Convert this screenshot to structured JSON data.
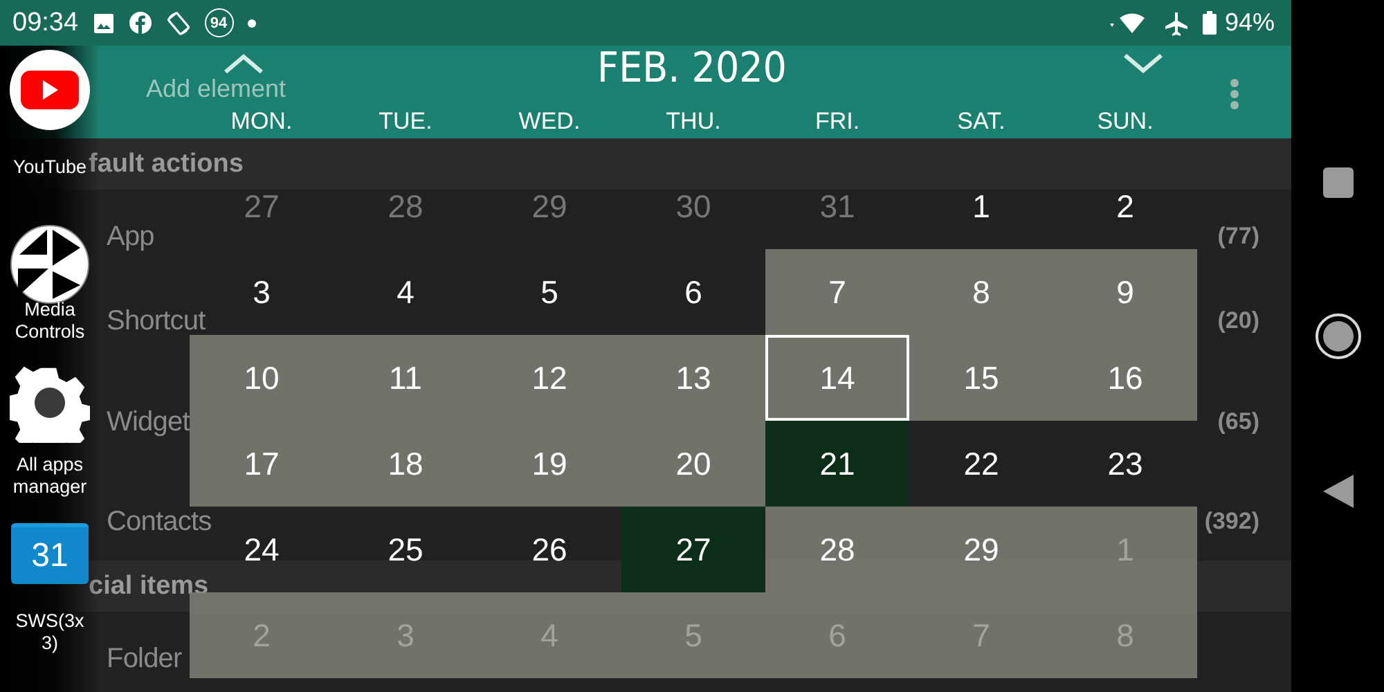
{
  "status_bar": {
    "time": "09:34",
    "notification_count": "94",
    "battery": "94%"
  },
  "header": {
    "add_label": "Add element",
    "title": "FEB. 2020",
    "weekdays": [
      "MON.",
      "TUE.",
      "WED.",
      "THU.",
      "FRI.",
      "SAT.",
      "SUN."
    ]
  },
  "calendar": {
    "weeks": [
      [
        {
          "day": "27",
          "muted": true,
          "kind": "plain",
          "today": false
        },
        {
          "day": "28",
          "muted": true,
          "kind": "plain",
          "today": false
        },
        {
          "day": "29",
          "muted": true,
          "kind": "plain",
          "today": false
        },
        {
          "day": "30",
          "muted": true,
          "kind": "plain",
          "today": false
        },
        {
          "day": "31",
          "muted": true,
          "kind": "plain",
          "today": false
        },
        {
          "day": "1",
          "muted": false,
          "kind": "plain",
          "today": false
        },
        {
          "day": "2",
          "muted": false,
          "kind": "plain",
          "today": false
        }
      ],
      [
        {
          "day": "3",
          "muted": false,
          "kind": "plain",
          "today": false
        },
        {
          "day": "4",
          "muted": false,
          "kind": "plain",
          "today": false
        },
        {
          "day": "5",
          "muted": false,
          "kind": "plain",
          "today": false
        },
        {
          "day": "6",
          "muted": false,
          "kind": "plain",
          "today": false
        },
        {
          "day": "7",
          "muted": false,
          "kind": "shaded",
          "today": false
        },
        {
          "day": "8",
          "muted": false,
          "kind": "shaded",
          "today": false
        },
        {
          "day": "9",
          "muted": false,
          "kind": "shaded",
          "today": false
        }
      ],
      [
        {
          "day": "10",
          "muted": false,
          "kind": "shaded",
          "today": false
        },
        {
          "day": "11",
          "muted": false,
          "kind": "shaded",
          "today": false
        },
        {
          "day": "12",
          "muted": false,
          "kind": "shaded",
          "today": false
        },
        {
          "day": "13",
          "muted": false,
          "kind": "shaded",
          "today": false
        },
        {
          "day": "14",
          "muted": false,
          "kind": "shaded",
          "today": true
        },
        {
          "day": "15",
          "muted": false,
          "kind": "shaded",
          "today": false
        },
        {
          "day": "16",
          "muted": false,
          "kind": "shaded",
          "today": false
        }
      ],
      [
        {
          "day": "17",
          "muted": false,
          "kind": "shaded",
          "today": false
        },
        {
          "day": "18",
          "muted": false,
          "kind": "shaded",
          "today": false
        },
        {
          "day": "19",
          "muted": false,
          "kind": "shaded",
          "today": false
        },
        {
          "day": "20",
          "muted": false,
          "kind": "shaded",
          "today": false
        },
        {
          "day": "21",
          "muted": false,
          "kind": "event",
          "today": false
        },
        {
          "day": "22",
          "muted": false,
          "kind": "plain",
          "today": false
        },
        {
          "day": "23",
          "muted": false,
          "kind": "plain",
          "today": false
        }
      ],
      [
        {
          "day": "24",
          "muted": false,
          "kind": "plain",
          "today": false
        },
        {
          "day": "25",
          "muted": false,
          "kind": "plain",
          "today": false
        },
        {
          "day": "26",
          "muted": false,
          "kind": "plain",
          "today": false
        },
        {
          "day": "27",
          "muted": false,
          "kind": "event",
          "today": false
        },
        {
          "day": "28",
          "muted": false,
          "kind": "shaded",
          "today": false
        },
        {
          "day": "29",
          "muted": false,
          "kind": "shaded",
          "today": false
        },
        {
          "day": "1",
          "muted": true,
          "kind": "shaded",
          "today": false
        }
      ],
      [
        {
          "day": "2",
          "muted": true,
          "kind": "shaded",
          "today": false
        },
        {
          "day": "3",
          "muted": true,
          "kind": "shaded",
          "today": false
        },
        {
          "day": "4",
          "muted": true,
          "kind": "shaded",
          "today": false
        },
        {
          "day": "5",
          "muted": true,
          "kind": "shaded",
          "today": false
        },
        {
          "day": "6",
          "muted": true,
          "kind": "shaded",
          "today": false
        },
        {
          "day": "7",
          "muted": true,
          "kind": "shaded",
          "today": false
        },
        {
          "day": "8",
          "muted": true,
          "kind": "shaded",
          "today": false
        }
      ]
    ]
  },
  "element_list": {
    "sections": [
      {
        "title": "fault actions",
        "items": [
          {
            "label": "App",
            "count": "(77)"
          },
          {
            "label": "Shortcut",
            "count": "(20)"
          },
          {
            "label": "Widget",
            "count": "(65)"
          },
          {
            "label": "Contacts",
            "count": "(392)"
          }
        ]
      },
      {
        "title": "cial items",
        "items": [
          {
            "label": "Folder"
          }
        ]
      }
    ]
  },
  "dock": [
    {
      "kind": "video",
      "label": "YouTube"
    },
    {
      "kind": "media",
      "label": "Media Controls"
    },
    {
      "kind": "settings",
      "label": "All apps manager"
    },
    {
      "kind": "calendar",
      "label": "SWS(3x3)",
      "icon_text": "31"
    }
  ]
}
